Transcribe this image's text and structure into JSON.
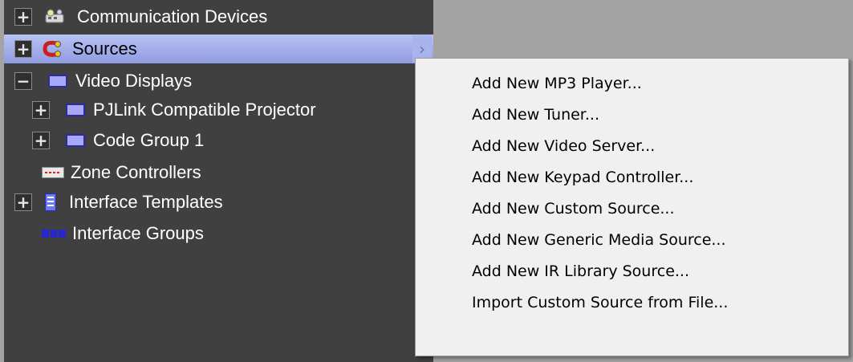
{
  "tree": {
    "items": [
      {
        "label": "Communication Devices",
        "expander": "+",
        "icon": "devices-icon"
      },
      {
        "label": "Sources",
        "expander": "+",
        "icon": "sources-icon",
        "selected": true
      },
      {
        "label": "Video Displays",
        "expander": "−",
        "icon": "display-icon"
      },
      {
        "label": "PJLink Compatible Projector",
        "expander": "+",
        "icon": "display-icon"
      },
      {
        "label": "Code Group 1",
        "expander": "+",
        "icon": "display-icon"
      },
      {
        "label": "Zone Controllers",
        "icon": "zone-controller-icon"
      },
      {
        "label": "Interface Templates",
        "expander": "+",
        "icon": "template-icon"
      },
      {
        "label": "Interface Groups",
        "icon": "interface-groups-icon"
      }
    ],
    "submenu_arrow": "›"
  },
  "context_menu": {
    "items": [
      {
        "label": "Add New MP3 Player..."
      },
      {
        "label": "Add New Tuner..."
      },
      {
        "label": "Add New Video Server..."
      },
      {
        "label": "Add New Keypad Controller..."
      },
      {
        "label": "Add New Custom Source..."
      },
      {
        "label": "Add New Generic Media Source..."
      },
      {
        "label": "Add New IR Library Source..."
      },
      {
        "label": "Import Custom Source from File..."
      }
    ]
  },
  "colors": {
    "tree_background": "#404040",
    "selection": "#a9b3ec",
    "menu_background": "#f0f0f0",
    "desktop_background": "#a3a3a3"
  }
}
